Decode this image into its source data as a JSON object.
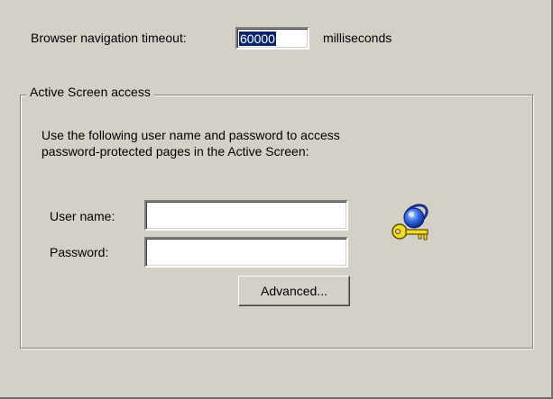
{
  "navigation": {
    "timeout_label": "Browser navigation timeout:",
    "timeout_value": "60000",
    "timeout_unit": "milliseconds"
  },
  "active_screen": {
    "group_title": "Active Screen access",
    "description_line1": "Use the following user name and password to access",
    "description_line2": "password-protected pages in the Active Screen:",
    "username_label": "User name:",
    "username_value": "",
    "password_label": "Password:",
    "password_value": "",
    "advanced_button": "Advanced...",
    "icon": "globe-key-icon"
  }
}
